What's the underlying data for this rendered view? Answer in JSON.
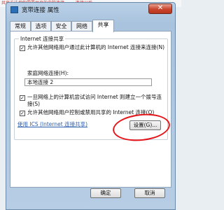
{
  "background": {
    "partial_text": "共享方法把你需要共享的电脑连接 …… 连接以后 ……"
  },
  "window": {
    "title": "宽带连接 属性"
  },
  "tabs": [
    {
      "label": "常规"
    },
    {
      "label": "选项"
    },
    {
      "label": "安全"
    },
    {
      "label": "网络"
    },
    {
      "label": "共享"
    }
  ],
  "ics": {
    "group_title": "Internet 连接共享",
    "allow_share_label": "允许其他网络用户通过此计算机的 Internet 连接来连接(N)",
    "allow_share_checked": true,
    "home_network_label": "家庭网络连接(H):",
    "home_network_value": "本地连接 2",
    "dial_on_demand_label": "一旦网络上的计算机尝试访问 Internet 则建立一个拨号连接(S)",
    "dial_on_demand_checked": true,
    "allow_control_label": "允许其他网络用户控制或禁用共享的 Internet 连接(O)",
    "allow_control_checked": true,
    "help_link": "使用 ICS (Internet 连接共享)",
    "settings_button": "设置(G)..."
  },
  "footer": {
    "ok_button": "确定",
    "cancel_button": "取消"
  },
  "colors": {
    "highlight_ellipse": "#e4161b",
    "link": "#2a5db0"
  }
}
